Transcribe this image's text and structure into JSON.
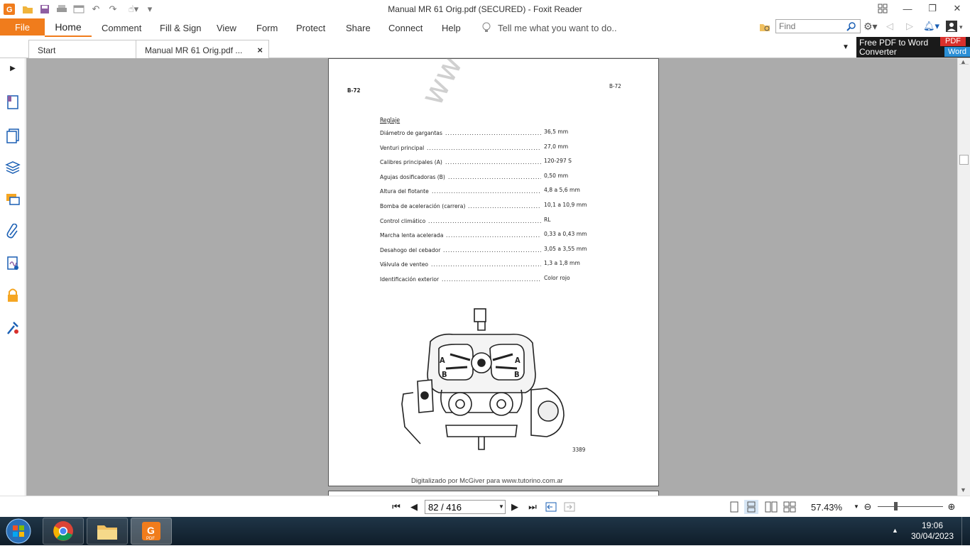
{
  "window": {
    "title": "Manual MR 61 Orig.pdf (SECURED) - Foxit Reader"
  },
  "ribbon": {
    "file": "File",
    "tabs": [
      "Home",
      "Comment",
      "Fill & Sign",
      "View",
      "Form",
      "Protect",
      "Share",
      "Connect",
      "Help"
    ],
    "tell_me": "Tell me what you want to do..",
    "find_placeholder": "Find"
  },
  "doc_tabs": {
    "start": "Start",
    "current": "Manual MR 61 Orig.pdf ...",
    "close": "×"
  },
  "promo": {
    "line1": "Free PDF to Word",
    "line2": "Converter",
    "badge_top": "PDF",
    "badge_bottom": "Word"
  },
  "pdf_page": {
    "page_label_left": "B-72",
    "page_label_right": "B-72",
    "section_title": "Reglaje",
    "specs": [
      {
        "label": "Diámetro de gargantas",
        "value": "36,5 mm"
      },
      {
        "label": "Venturi principal",
        "value": "27,0 mm"
      },
      {
        "label": "Calibres principales (A)",
        "value": "120-297 S"
      },
      {
        "label": "Agujas dosificadoras (B)",
        "value": "0,50 mm"
      },
      {
        "label": "Altura del flotante",
        "value": "4,8 a 5,6 mm"
      },
      {
        "label": "Bomba de aceleración (carrera)",
        "value": "10,1 a 10,9 mm"
      },
      {
        "label": "Control climático",
        "value": "RL"
      },
      {
        "label": "Marcha lenta acelerada",
        "value": "0,33 a 0,43 mm"
      },
      {
        "label": "Desahogo del cebador",
        "value": "3,05 a 3,55 mm"
      },
      {
        "label": "Válvula de venteo",
        "value": "1,3 a 1,8 mm"
      },
      {
        "label": "Identificación exterior",
        "value": "Color rojo"
      }
    ],
    "figure_labels": {
      "a_left": "A",
      "a_right": "A",
      "b_left": "B",
      "b_right": "B"
    },
    "figure_number": "3389",
    "watermark": "www.tutorino.com.ar",
    "footer": "Digitalizado por McGiver para www.tutorino.com.ar"
  },
  "statusbar": {
    "page_indicator": "82 / 416",
    "zoom": "57.43%"
  },
  "taskbar": {
    "apps": [
      "chrome-icon",
      "file-explorer-icon",
      "foxit-pdf-icon"
    ],
    "time": "19:06",
    "date": "30/04/2023"
  },
  "colors": {
    "accent": "#f07c1c",
    "viewer_bg": "#ababab",
    "taskbar": "#1f3547"
  }
}
